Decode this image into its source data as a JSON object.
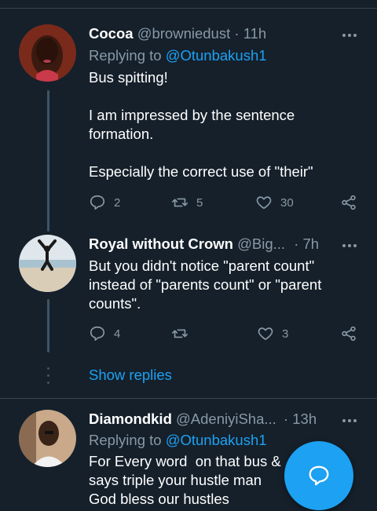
{
  "tweets": [
    {
      "name": "Cocoa",
      "handle": "@browniedust",
      "dot": "·",
      "time": "11h",
      "replying_label": "Replying to",
      "replying_to": "@Otunbakush1",
      "paragraphs": [
        "Bus spitting!",
        "I am impressed by the sentence formation.",
        "Especially the correct use of \"their\""
      ],
      "replies": "2",
      "retweets": "5",
      "likes": "30"
    },
    {
      "name": "Royal without Crown",
      "handle": "@Big...",
      "dot": "·",
      "time": "7h",
      "paragraphs": [
        "But you didn't notice \"parent count\" instead of \"parents count\" or \"parent counts\"."
      ],
      "replies": "4",
      "retweets": "",
      "likes": "3"
    },
    {
      "name": "Diamondkid",
      "handle": "@AdeniyiSha...",
      "dot": "·",
      "time": "13h",
      "replying_label": "Replying to",
      "replying_to": "@Otunbakush1",
      "lines": [
        "For Every word  on that bus &",
        "says triple your hustle man",
        "God bless our hustles"
      ]
    }
  ],
  "show_replies": "Show replies",
  "icons": {
    "reply": "reply-icon",
    "retweet": "retweet-icon",
    "like": "heart-icon",
    "share": "share-icon",
    "more": "more-icon",
    "compose": "compose-reply-icon"
  },
  "colors": {
    "background": "#15202b",
    "accent": "#1da1f2",
    "muted": "#8899a6",
    "divider": "#38444d"
  }
}
